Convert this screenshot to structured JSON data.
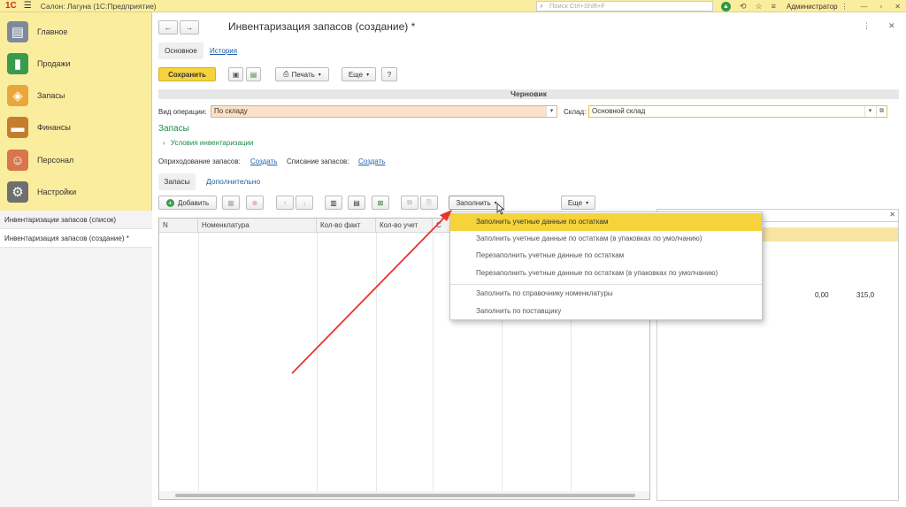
{
  "app": {
    "logo": "1С",
    "title": "Салон: Лагуна  (1С:Предприятие)",
    "search_placeholder": "Поиск Ctrl+Shift+F",
    "user": "Администратор"
  },
  "sidebar": {
    "items": [
      {
        "label": "Главное",
        "icon": "home-icon"
      },
      {
        "label": "Продажи",
        "icon": "sales-icon"
      },
      {
        "label": "Запасы",
        "icon": "stock-icon"
      },
      {
        "label": "Финансы",
        "icon": "finance-icon"
      },
      {
        "label": "Персонал",
        "icon": "staff-icon"
      },
      {
        "label": "Настройки",
        "icon": "settings-icon"
      }
    ],
    "open_windows": [
      {
        "label": "Инвентаризации запасов (список)"
      },
      {
        "label": "Инвентаризация запасов (создание) *"
      }
    ]
  },
  "document": {
    "title": "Инвентаризация запасов (создание) *",
    "tabs": [
      {
        "label": "Основное"
      },
      {
        "label": "История"
      }
    ],
    "toolbar": {
      "save": "Сохранить",
      "print": "Печать",
      "more": "Еще",
      "help": "?"
    },
    "status": "Черновик",
    "operation_label": "Вид операции:",
    "operation_value": "По складу",
    "warehouse_label": "Склад:",
    "warehouse_value": "Основной склад",
    "section_title": "Запасы",
    "conditions_link": "Условия инвентаризации",
    "receipt_label": "Оприходование запасов:",
    "receipt_link": "Создать",
    "writeoff_label": "Списание запасов:",
    "writeoff_link": "Создать",
    "subtabs": [
      {
        "label": "Запасы"
      },
      {
        "label": "Дополнительно"
      }
    ],
    "table_toolbar": {
      "add": "Добавить",
      "fill": "Заполнить",
      "more": "Еще"
    },
    "columns": [
      "N",
      "Номенклатура",
      "Кол-во факт",
      "Кол-во учет",
      "С"
    ]
  },
  "right_panel": {
    "values": [
      "0,00",
      "315,0"
    ]
  },
  "fill_menu": {
    "items": [
      "Заполнить учетные данные по остаткам",
      "Заполнить учетные данные по остаткам (в упаковках по умолчанию)",
      "Перезаполнить учетные данные по остаткам",
      "Перезаполнить учетные данные по остаткам (в упаковках по умолчанию)",
      "Заполнить по справочнику номенклатуры",
      "Заполнить по поставщику"
    ],
    "highlighted_index": 0
  },
  "colors": {
    "accent_yellow": "#f6d33b",
    "sidebar_bg": "#fbed9e",
    "link": "#1d5fa8",
    "section_green": "#1f8a4c",
    "arrow_red": "#e8352a"
  }
}
